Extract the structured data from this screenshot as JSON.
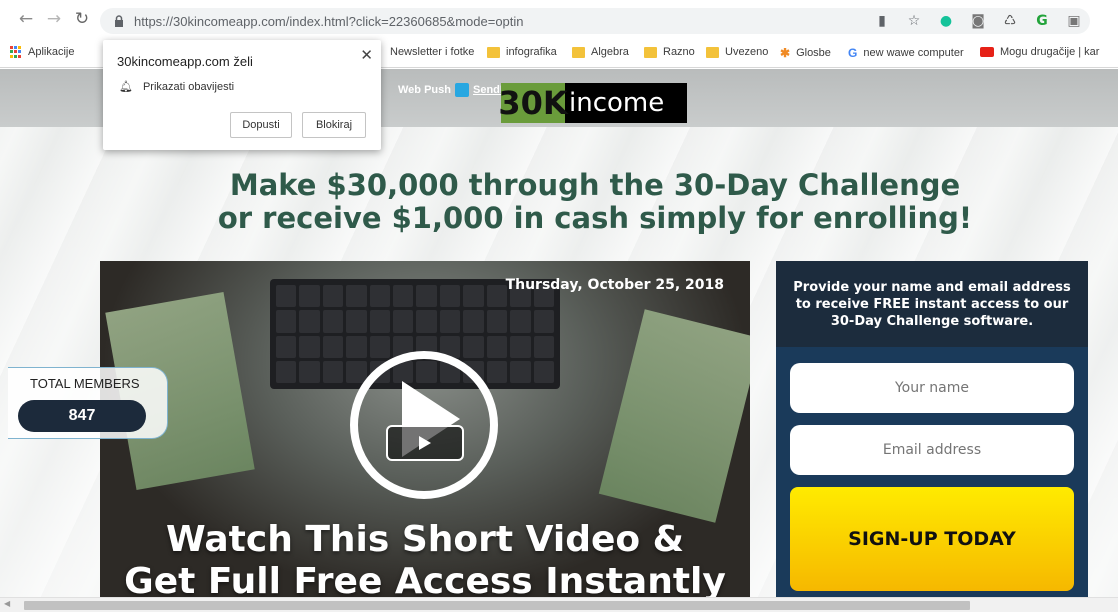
{
  "browser": {
    "url": "https://30kincomeapp.com/index.html?click=22360685&mode=optin",
    "bookmarks": [
      {
        "label": "Aplikacije",
        "kind": "apps"
      },
      {
        "label": "Newsletter i fotke",
        "kind": "folder"
      },
      {
        "label": "infografika",
        "kind": "folder"
      },
      {
        "label": "Algebra",
        "kind": "folder"
      },
      {
        "label": "Razno",
        "kind": "folder"
      },
      {
        "label": "Uvezeno",
        "kind": "folder"
      },
      {
        "label": "Glosbe",
        "kind": "site"
      },
      {
        "label": "new wawe computer",
        "kind": "google"
      },
      {
        "label": "Mogu drugačije | kar",
        "kind": "youtube"
      }
    ]
  },
  "permission_popup": {
    "title": "30kincomeapp.com želi",
    "item": "Prikazati obavijesti",
    "allow": "Dopusti",
    "block": "Blokiraj"
  },
  "header": {
    "webpush": "Web Push",
    "sendpulse": "SendPulse",
    "logo_num": "30K",
    "logo_text": "income"
  },
  "headline": {
    "line1": "Make $30,000 through the 30-Day Challenge",
    "line2": "or receive $1,000 in cash simply for enrolling!"
  },
  "video": {
    "date": "Thursday, October 25, 2018",
    "cta_line1": "Watch This Short Video &",
    "cta_line2": "Get Full Free Access Instantly"
  },
  "members": {
    "label": "TOTAL MEMBERS",
    "count": "847"
  },
  "form": {
    "intro": "Provide your name and email address to receive FREE instant access to our 30-Day Challenge software.",
    "name_placeholder": "Your name",
    "email_placeholder": "Email address",
    "submit": "SIGN-UP TODAY"
  },
  "colors": {
    "headline": "#2f5a4a",
    "form_bg": "#1a3a5a",
    "signup": "#ffd400",
    "members_pill": "#1c2a3b"
  }
}
